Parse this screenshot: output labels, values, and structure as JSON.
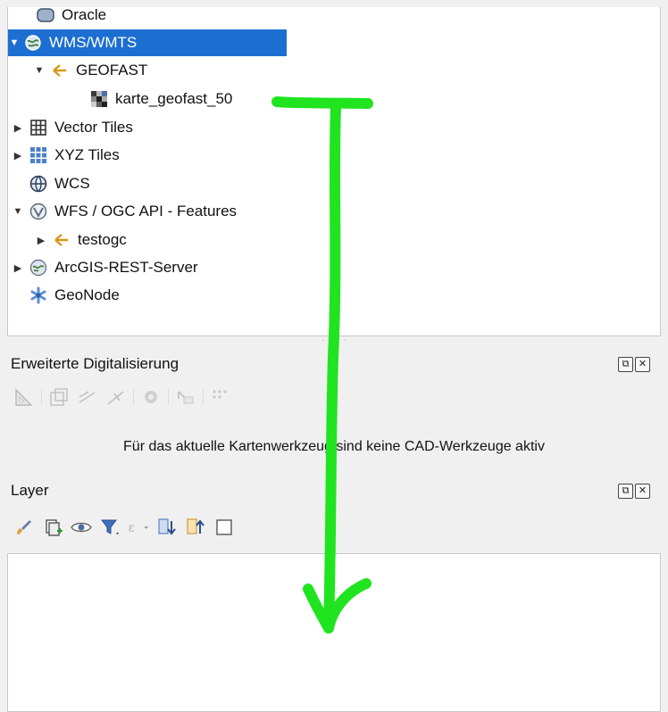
{
  "browser": {
    "items": [
      {
        "label": "Oracle",
        "icon": "database-icon"
      },
      {
        "label": "WMS/WMTS",
        "icon": "globe-icon",
        "selected": true
      },
      {
        "label": "GEOFAST",
        "icon": "connection-icon"
      },
      {
        "label": "karte_geofast_50",
        "icon": "raster-layer-icon"
      },
      {
        "label": "Vector Tiles",
        "icon": "vector-tiles-icon"
      },
      {
        "label": "XYZ Tiles",
        "icon": "xyz-tiles-icon"
      },
      {
        "label": "WCS",
        "icon": "wcs-icon"
      },
      {
        "label": "WFS / OGC API - Features",
        "icon": "wfs-icon"
      },
      {
        "label": "testogc",
        "icon": "connection-icon"
      },
      {
        "label": "ArcGIS-REST-Server",
        "icon": "arcgis-icon"
      },
      {
        "label": "GeoNode",
        "icon": "geonode-icon"
      }
    ]
  },
  "digitizing": {
    "title": "Erweiterte Digitalisierung",
    "message": "Für das aktuelle Kartenwerkzeug sind keine CAD-Werkzeuge aktiv"
  },
  "layers": {
    "title": "Layer"
  },
  "annotation": {
    "color": "#1fe41f",
    "icon": "drag-arrow-annotation"
  },
  "colors": {
    "selection": "#1c6fd1"
  }
}
